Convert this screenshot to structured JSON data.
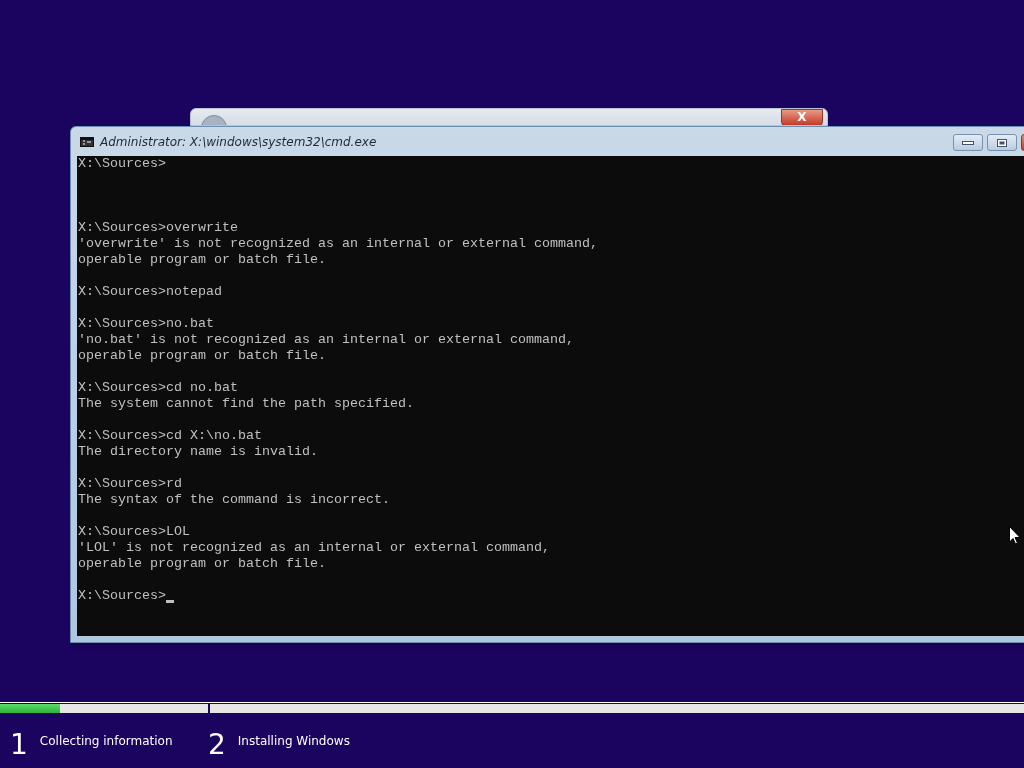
{
  "background_window": {
    "close_button": "X"
  },
  "console_window": {
    "title": "Administrator: X:\\windows\\system32\\cmd.exe",
    "lines": [
      {
        "kind": "text",
        "text": "X:\\Sources>"
      },
      {
        "kind": "blank"
      },
      {
        "kind": "blank"
      },
      {
        "kind": "blank"
      },
      {
        "kind": "text",
        "text": "X:\\Sources>overwrite"
      },
      {
        "kind": "text",
        "text": "'overwrite' is not recognized as an internal or external command,"
      },
      {
        "kind": "text",
        "text": "operable program or batch file."
      },
      {
        "kind": "blank"
      },
      {
        "kind": "text",
        "text": "X:\\Sources>notepad"
      },
      {
        "kind": "blank"
      },
      {
        "kind": "text",
        "text": "X:\\Sources>no.bat"
      },
      {
        "kind": "text",
        "text": "'no.bat' is not recognized as an internal or external command,"
      },
      {
        "kind": "text",
        "text": "operable program or batch file."
      },
      {
        "kind": "blank"
      },
      {
        "kind": "text",
        "text": "X:\\Sources>cd no.bat"
      },
      {
        "kind": "text",
        "text": "The system cannot find the path specified."
      },
      {
        "kind": "blank"
      },
      {
        "kind": "text",
        "text": "X:\\Sources>cd X:\\no.bat"
      },
      {
        "kind": "text",
        "text": "The directory name is invalid."
      },
      {
        "kind": "blank"
      },
      {
        "kind": "text",
        "text": "X:\\Sources>rd"
      },
      {
        "kind": "text",
        "text": "The syntax of the command is incorrect."
      },
      {
        "kind": "blank"
      },
      {
        "kind": "text",
        "text": "X:\\Sources>LOL"
      },
      {
        "kind": "text",
        "text": "'LOL' is not recognized as an internal or external command,"
      },
      {
        "kind": "text",
        "text": "operable program or batch file."
      },
      {
        "kind": "blank"
      },
      {
        "kind": "input",
        "text": "X:\\Sources>"
      }
    ]
  },
  "setup_steps": [
    {
      "number": "1",
      "label": "Collecting information",
      "level": 0.29
    },
    {
      "number": "2",
      "label": "Installing Windows",
      "level": 0
    }
  ]
}
